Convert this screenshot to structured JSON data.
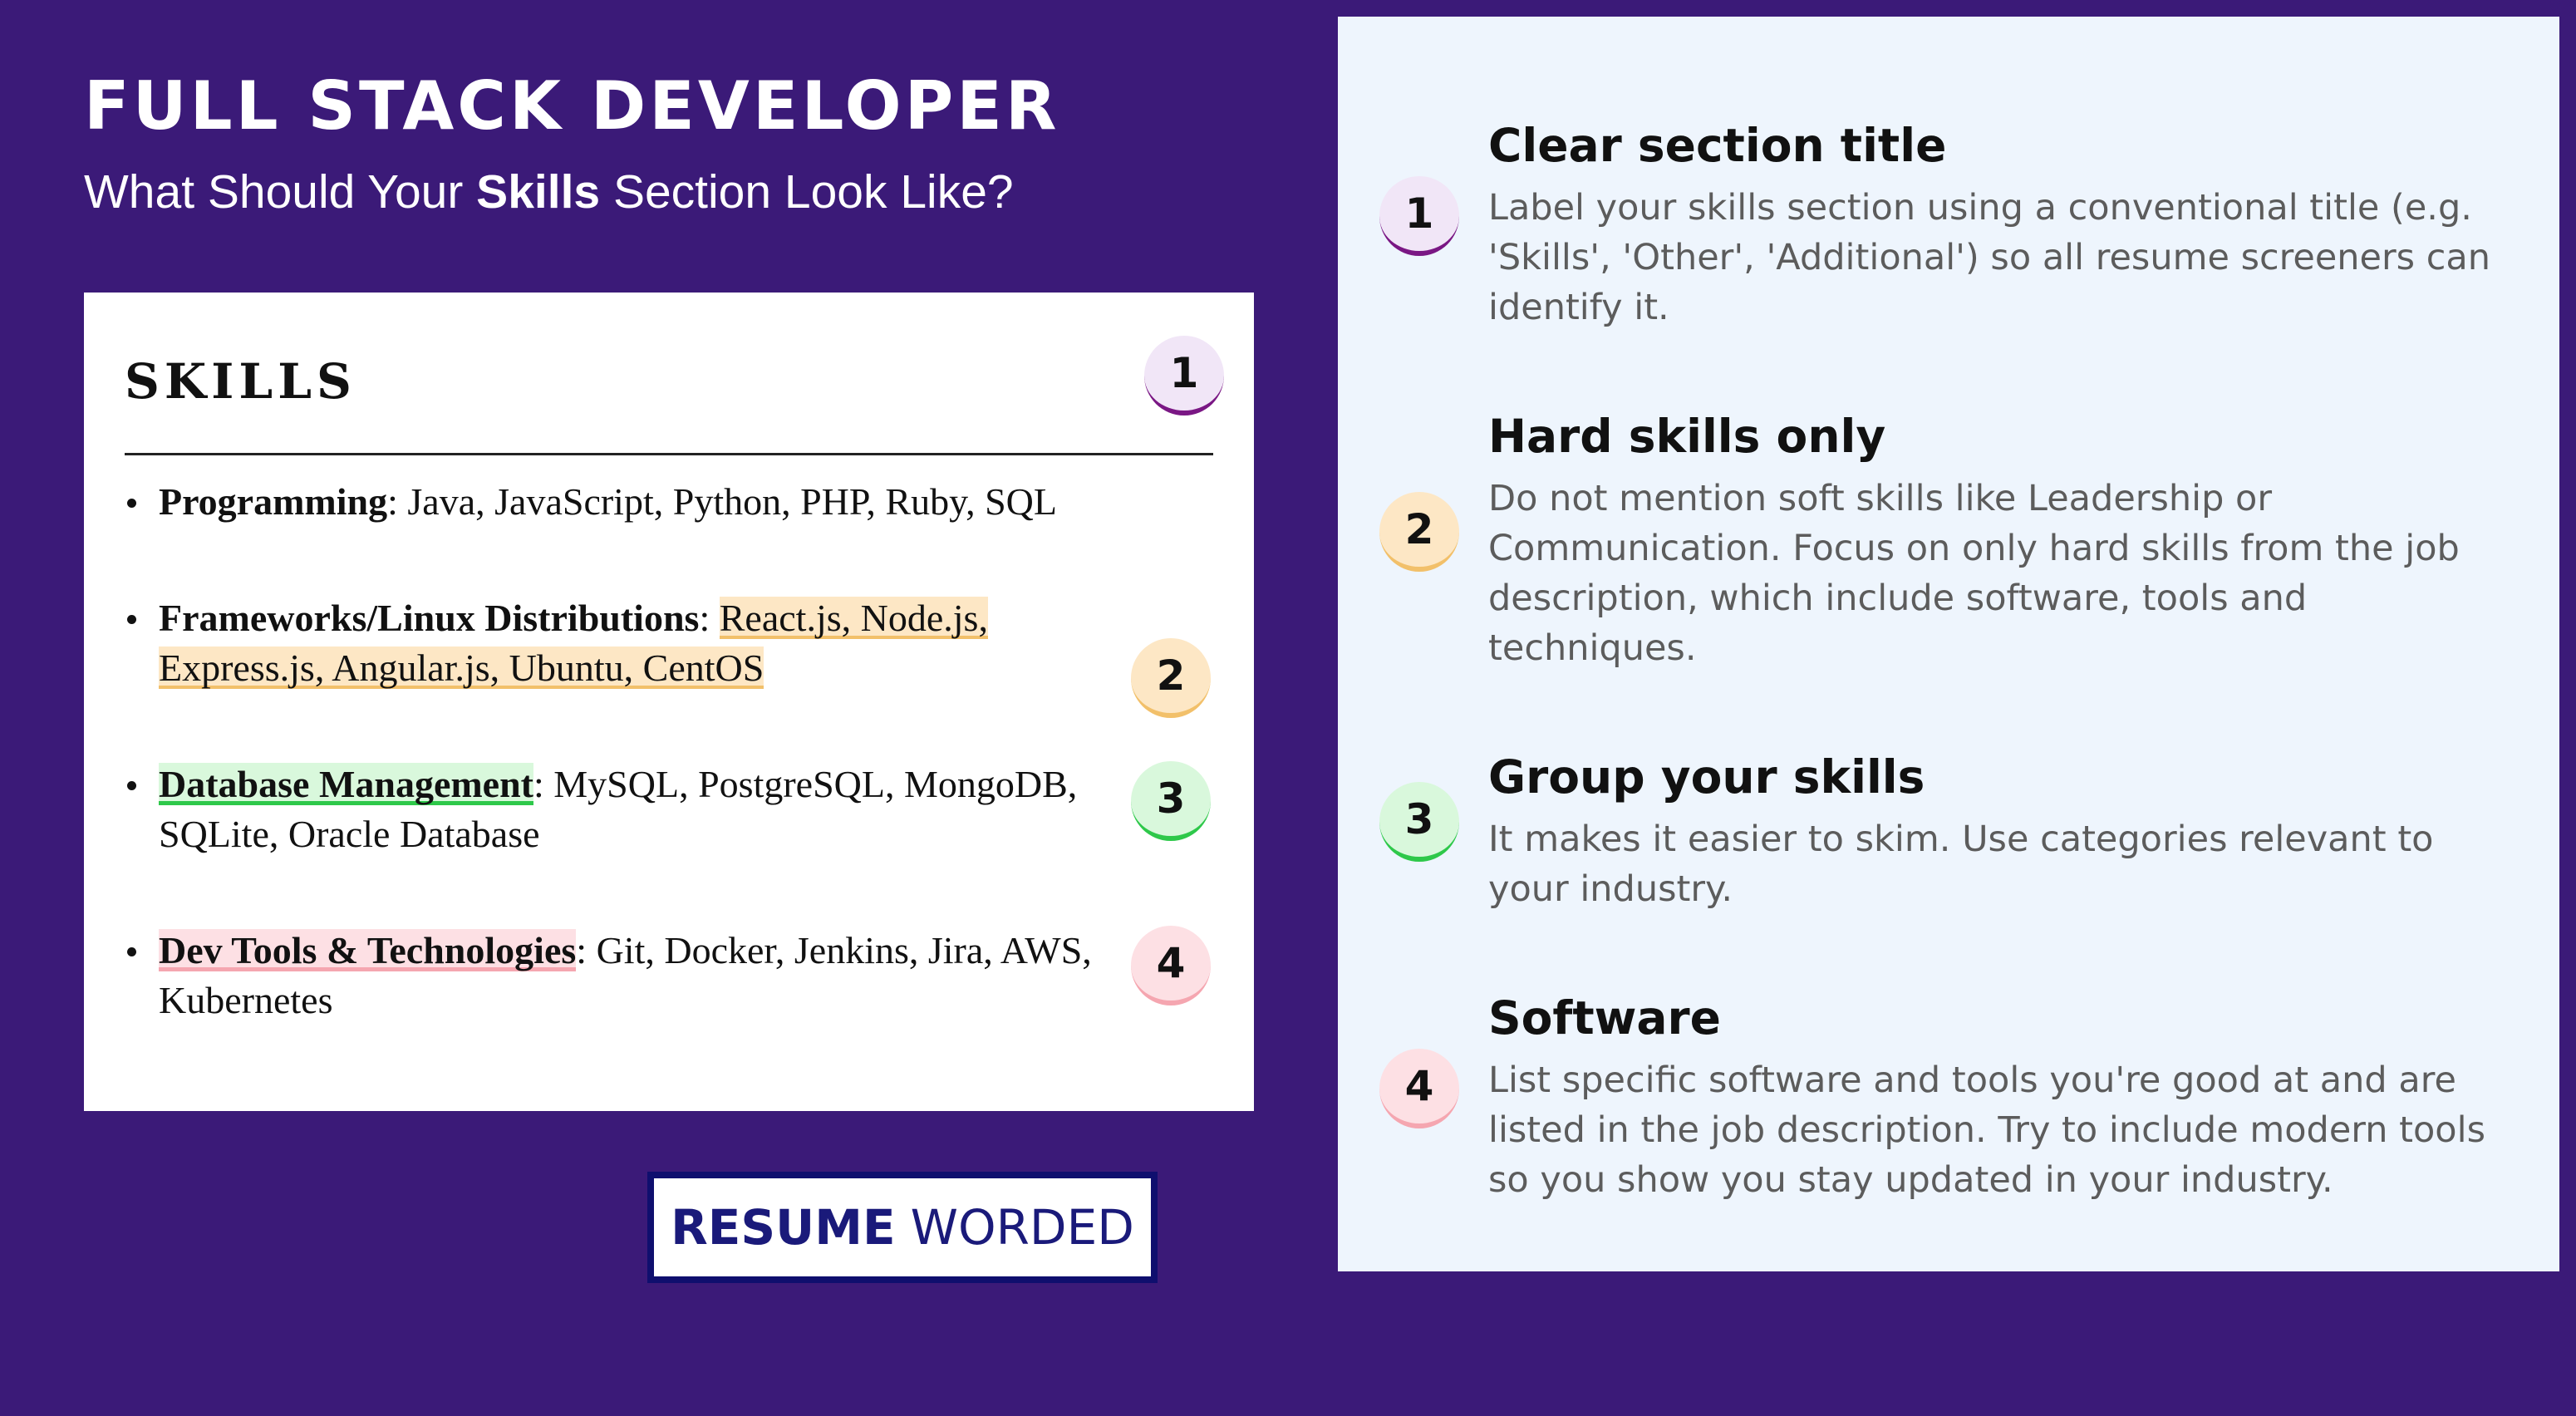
{
  "header": {
    "title": "FULL STACK DEVELOPER",
    "subtitle_before": "What Should Your ",
    "subtitle_bold": "Skills",
    "subtitle_after": " Section Look Like?"
  },
  "resume": {
    "section_heading": "SKILLS",
    "items": [
      {
        "category": "Programming",
        "separator": ": ",
        "text": "Java, JavaScript, Python, PHP, Ruby, SQL"
      },
      {
        "category": "Frameworks/Linux Distributions",
        "separator": ": ",
        "text": "React.js, Node.js, Express.js, Angular.js, Ubuntu, CentOS"
      },
      {
        "category": "Database Management",
        "separator": ": ",
        "text": "MySQL, PostgreSQL, MongoDB, SQLite, Oracle Database"
      },
      {
        "category": "Dev Tools & Technologies",
        "separator": ": ",
        "text": "Git, Docker, Jenkins, Jira, AWS, Kubernetes"
      }
    ]
  },
  "markers": [
    "1",
    "2",
    "3",
    "4"
  ],
  "logo": {
    "strong": "RESUME",
    "light": "WORDED"
  },
  "tips": [
    {
      "number": "1",
      "title": "Clear section title",
      "body": "Label your skills section using a conventional title (e.g. 'Skills', 'Other', 'Additional') so all resume screeners can identify it."
    },
    {
      "number": "2",
      "title": "Hard skills only",
      "body": "Do not mention soft skills like Leadership or Communication. Focus on only hard skills from the job description, which include software, tools and techniques."
    },
    {
      "number": "3",
      "title": "Group your skills",
      "body": "It makes it easier to skim. Use categories relevant to your industry."
    },
    {
      "number": "4",
      "title": "Software",
      "body": "List specific software and tools you're good at and are listed in the job description. Try to include modern tools so you show you stay updated in your industry."
    }
  ],
  "colors": {
    "background": "#3b1a78",
    "panel": "#eef5fd",
    "marker_1": "#7a1784",
    "marker_2": "#f2c06a",
    "marker_3": "#2ec84a",
    "marker_4": "#f5a6b0",
    "logo": "#0f0f6e"
  }
}
